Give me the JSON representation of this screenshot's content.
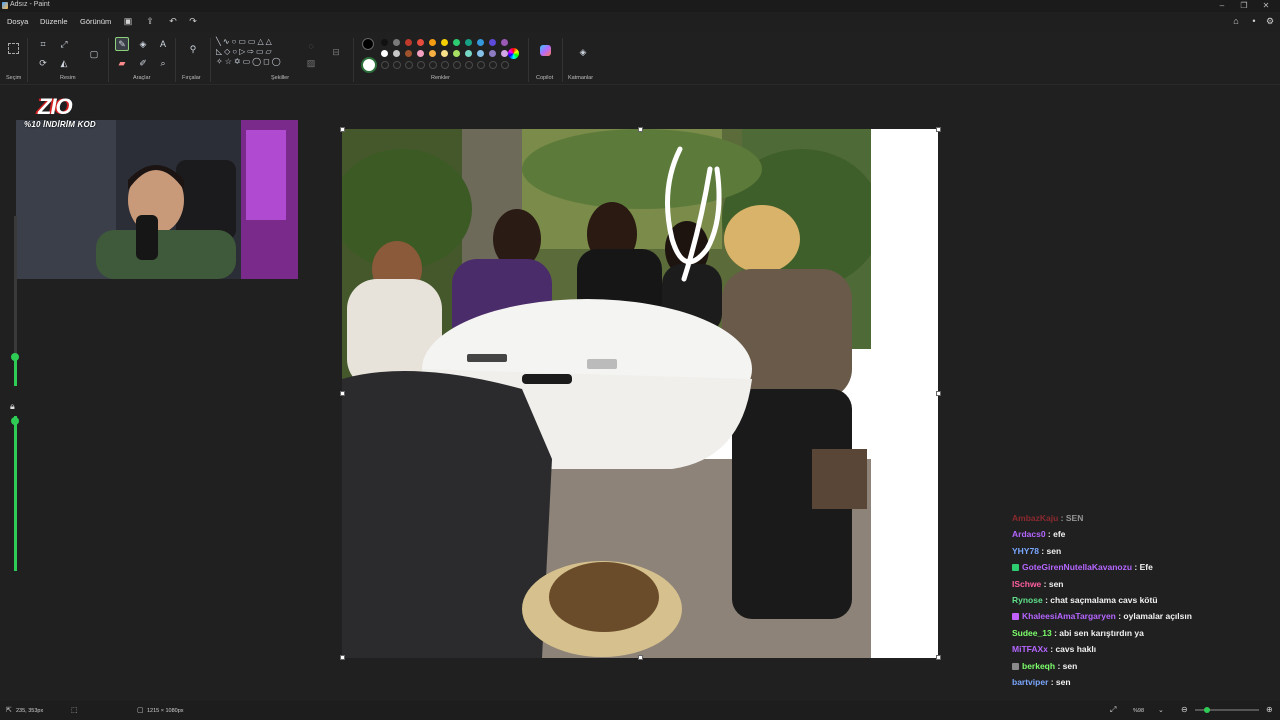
{
  "window": {
    "title": "Adsız - Paint"
  },
  "menu": {
    "file": "Dosya",
    "edit": "Düzenle",
    "view": "Görünüm"
  },
  "ribbon": {
    "groups": {
      "selection": "Seçim",
      "image": "Resim",
      "tools": "Araçlar",
      "brushes": "Fırçalar",
      "shapes": "Şekiller",
      "colors": "Renkler",
      "copilot": "Copilot",
      "layers": "Katmanlar"
    },
    "palette_row1": [
      "#111111",
      "#7a7a7a",
      "#c0392b",
      "#e74c3c",
      "#f39c12",
      "#f5d000",
      "#2ecc71",
      "#16a085",
      "#3498db",
      "#5b4bd8",
      "#9b59b6"
    ],
    "palette_row2": [
      "#ffffff",
      "#c8c8c8",
      "#a0522d",
      "#f2a2c0",
      "#f5b041",
      "#f7e08a",
      "#a8e063",
      "#76d7c4",
      "#85c1e9",
      "#8e7cc3",
      "#d2a6e6"
    ]
  },
  "stream": {
    "logo_text": "ZIO",
    "promo": "%10 İNDİRİM KOD"
  },
  "chat": [
    {
      "user": "AmbazKaju",
      "color": "#e0303a",
      "msg": "SEN",
      "badge": null
    },
    {
      "user": "Ardacs0",
      "color": "#b566ff",
      "msg": "efe",
      "badge": null
    },
    {
      "user": "YHY78",
      "color": "#7aa7ff",
      "msg": "sen",
      "badge": null
    },
    {
      "user": "GoteGirenNutellaKavanozu",
      "color": "#b566ff",
      "msg": "Efe",
      "badge": "#2ecc71"
    },
    {
      "user": "ISchwe",
      "color": "#ff5fa2",
      "msg": "sen",
      "badge": null
    },
    {
      "user": "Rynose",
      "color": "#5fe08a",
      "msg": "chat saçmalama cavs kötü",
      "badge": null
    },
    {
      "user": "KhaleesiAmaTargaryen",
      "color": "#b566ff",
      "msg": "oylamalar açılsın",
      "badge": "#c060ff"
    },
    {
      "user": "Sudee_13",
      "color": "#7cff6b",
      "msg": "abi sen karıştırdın ya",
      "badge": null
    },
    {
      "user": "MiTFAXx",
      "color": "#b566ff",
      "msg": "cavs haklı",
      "badge": null
    },
    {
      "user": "berkeqh",
      "color": "#7cff6b",
      "msg": "sen",
      "badge": "#8a8a8a"
    },
    {
      "user": "bartviper",
      "color": "#7aa7ff",
      "msg": "sen",
      "badge": null
    }
  ],
  "status": {
    "cursor": "235, 353px",
    "canvas_size": "1215 × 1080px",
    "zoom": "%98"
  }
}
